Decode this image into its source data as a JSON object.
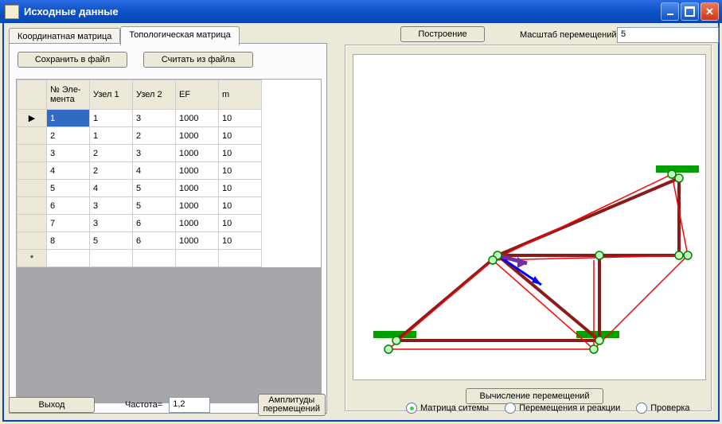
{
  "window": {
    "title": "Исходные данные"
  },
  "tabs": {
    "coord": "Координатная матрица",
    "topo": "Топологическая матрица"
  },
  "toolbar": {
    "save": "Сохранить в файл",
    "load": "Считать из файла"
  },
  "grid": {
    "headers": {
      "num": "№ Эле-\nмента",
      "n1": "Узел 1",
      "n2": "Узел 2",
      "ef": "EF",
      "m": "m"
    },
    "rows": [
      {
        "num": "1",
        "n1": "1",
        "n2": "3",
        "ef": "1000",
        "m": "10"
      },
      {
        "num": "2",
        "n1": "1",
        "n2": "2",
        "ef": "1000",
        "m": "10"
      },
      {
        "num": "3",
        "n1": "2",
        "n2": "3",
        "ef": "1000",
        "m": "10"
      },
      {
        "num": "4",
        "n1": "2",
        "n2": "4",
        "ef": "1000",
        "m": "10"
      },
      {
        "num": "5",
        "n1": "4",
        "n2": "5",
        "ef": "1000",
        "m": "10"
      },
      {
        "num": "6",
        "n1": "3",
        "n2": "5",
        "ef": "1000",
        "m": "10"
      },
      {
        "num": "7",
        "n1": "3",
        "n2": "6",
        "ef": "1000",
        "m": "10"
      },
      {
        "num": "8",
        "n1": "5",
        "n2": "6",
        "ef": "1000",
        "m": "10"
      }
    ],
    "row_marker": "▶",
    "new_marker": "*"
  },
  "bottom": {
    "exit": "Выход",
    "freq_label": "Частота=",
    "freq_value": "1,2",
    "ampl": "Амплитуды\nперемещений"
  },
  "right": {
    "build": "Построение",
    "scale_label": "Масштаб перемещений:",
    "scale_value": "5",
    "calc": "Вычисление перемещений",
    "radios": {
      "matrix": "Матрица ситемы",
      "disp": "Перемещения и реакции",
      "check": "Проверка"
    }
  }
}
